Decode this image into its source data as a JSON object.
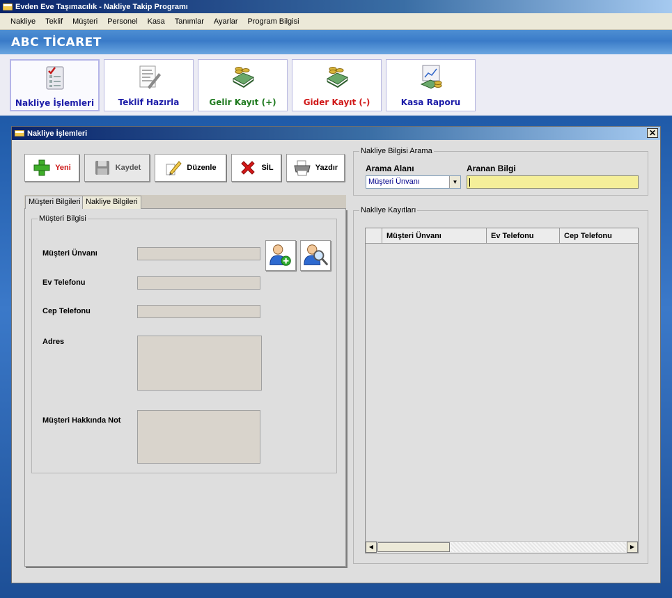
{
  "window": {
    "title": "Evden Eve Taşımacılık - Nakliye Takip Programı"
  },
  "menu": [
    "Nakliye",
    "Teklif",
    "Müşteri",
    "Personel",
    "Kasa",
    "Tanımlar",
    "Ayarlar",
    "Program Bilgisi"
  ],
  "company": {
    "name": "ABC TİCARET"
  },
  "quick": [
    {
      "label": "Nakliye İşlemleri",
      "color": "#1c1ca8",
      "icon": "checklist-icon"
    },
    {
      "label": "Teklif Hazırla",
      "color": "#1c1ca8",
      "icon": "document-pen-icon"
    },
    {
      "label": "Gelir Kayıt (+)",
      "color": "#1f7a1f",
      "icon": "money-coins-icon"
    },
    {
      "label": "Gider Kayıt (-)",
      "color": "#d01818",
      "icon": "money-coins-icon"
    },
    {
      "label": "Kasa Raporu",
      "color": "#1c1ca8",
      "icon": "report-chart-icon"
    }
  ],
  "child": {
    "title": "Nakliye İşlemleri",
    "close": "✕",
    "actions": {
      "new": "Yeni",
      "save": "Kaydet",
      "edit": "Düzenle",
      "delete": "SİL",
      "print": "Yazdır"
    },
    "tabs": [
      "Müşteri Bilgileri",
      "Nakliye Bilgileri"
    ],
    "customer": {
      "group": "Müşteri Bilgisi",
      "name_label": "Müşteri Ünvanı",
      "home_phone_label": "Ev Telefonu",
      "mobile_phone_label": "Cep Telefonu",
      "address_label": "Adres",
      "note_label": "Müşteri Hakkında Not"
    },
    "search": {
      "group": "Nakliye Bilgisi Arama",
      "field_label": "Arama Alanı",
      "value_label": "Aranan Bilgi",
      "field_selected": "Müşteri Ünvanı"
    },
    "records": {
      "group": "Nakliye Kayıtları",
      "columns": [
        "Müşteri Ünvanı",
        "Ev Telefonu",
        "Cep Telefonu"
      ]
    }
  },
  "colors": {
    "accent": "#3a6ea5",
    "search_bg": "#f5ef99",
    "delete_red": "#cc1111",
    "new_red": "#cc1111"
  }
}
